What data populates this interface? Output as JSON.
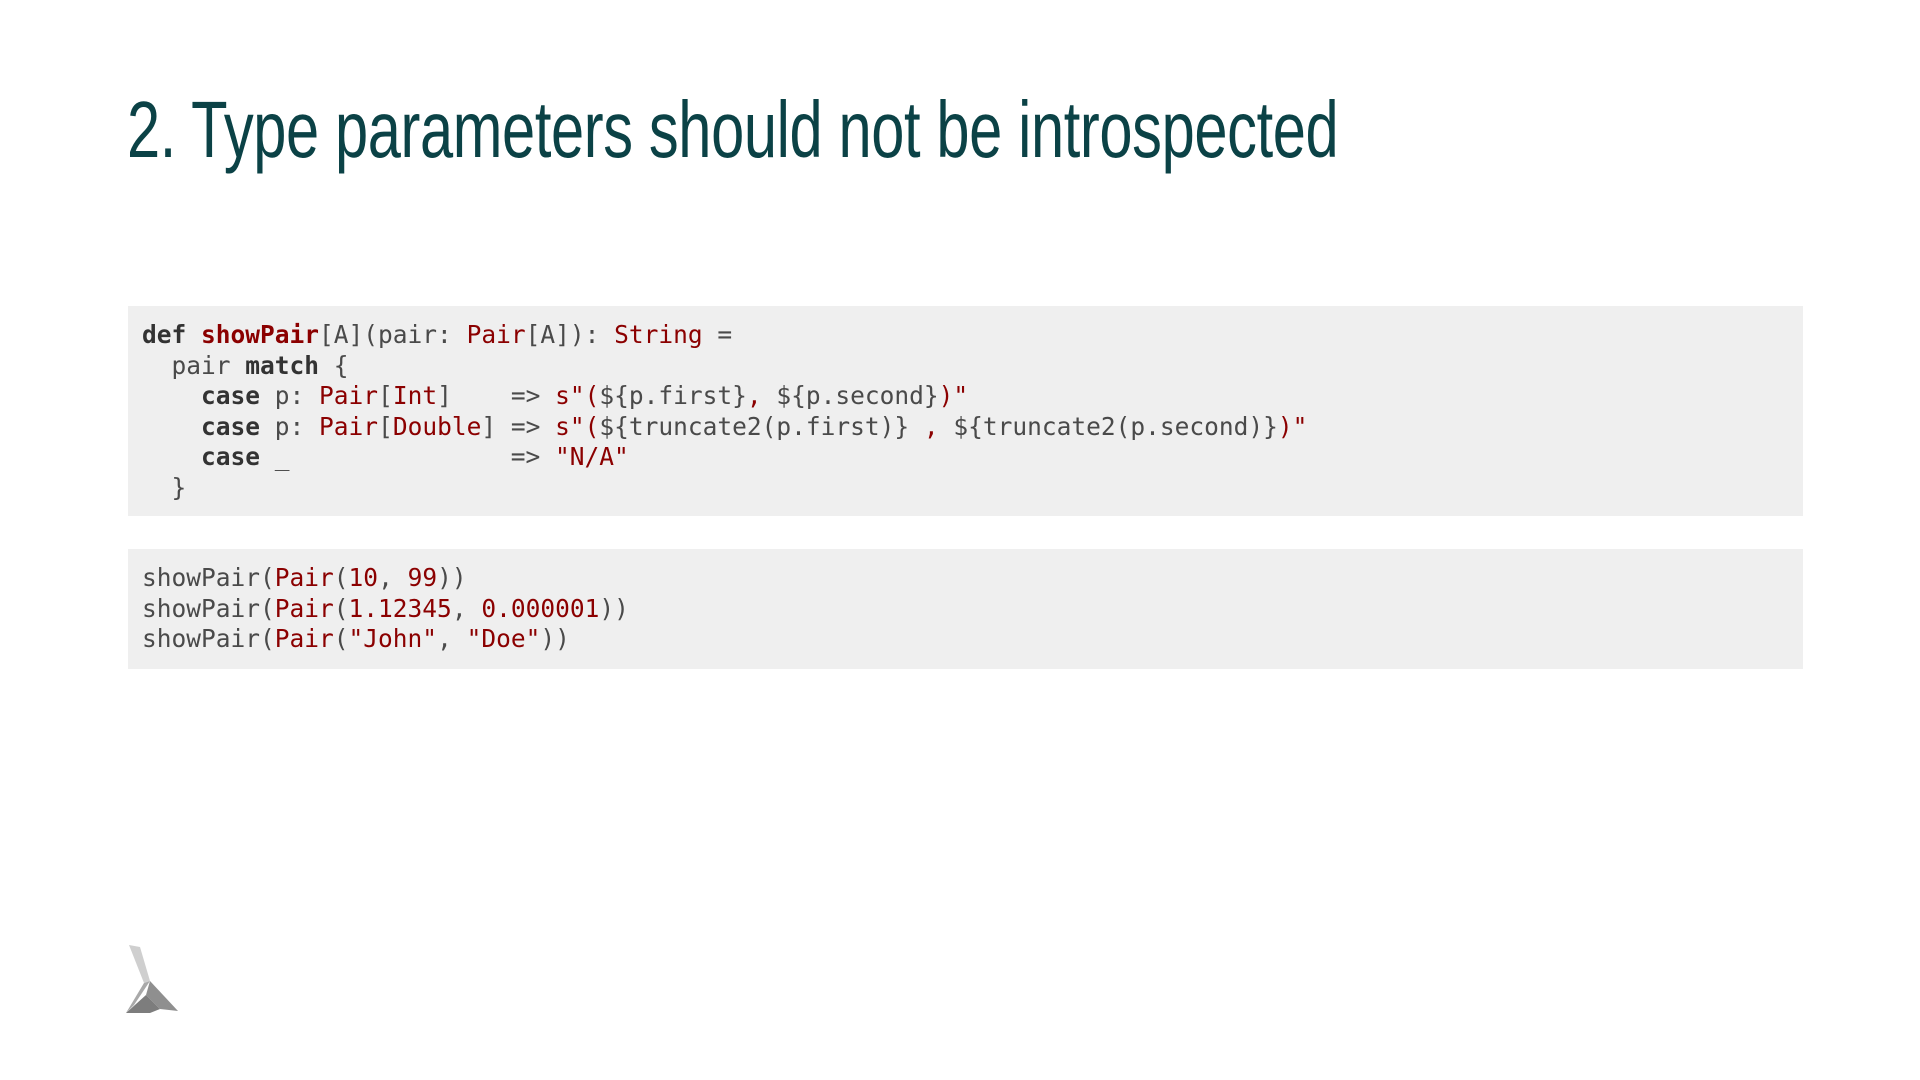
{
  "slide": {
    "title": "2. Type parameters should not be introspected"
  },
  "code_blocks": [
    {
      "lines": [
        [
          {
            "t": "def",
            "c": "kw"
          },
          {
            "t": " ",
            "c": "pl"
          },
          {
            "t": "showPair",
            "c": "fn"
          },
          {
            "t": "[A](pair: ",
            "c": "pl"
          },
          {
            "t": "Pair",
            "c": "ty"
          },
          {
            "t": "[A]): ",
            "c": "pl"
          },
          {
            "t": "String",
            "c": "ty"
          },
          {
            "t": " =",
            "c": "pl"
          }
        ],
        [
          {
            "t": "  pair ",
            "c": "pl"
          },
          {
            "t": "match",
            "c": "kw"
          },
          {
            "t": " {",
            "c": "pl"
          }
        ],
        [
          {
            "t": "    ",
            "c": "pl"
          },
          {
            "t": "case",
            "c": "kw"
          },
          {
            "t": " p: ",
            "c": "pl"
          },
          {
            "t": "Pair",
            "c": "ty"
          },
          {
            "t": "[",
            "c": "pl"
          },
          {
            "t": "Int",
            "c": "ty"
          },
          {
            "t": "]    => ",
            "c": "pl"
          },
          {
            "t": "s\"(",
            "c": "str"
          },
          {
            "t": "${p.first}",
            "c": "pl"
          },
          {
            "t": ", ",
            "c": "str"
          },
          {
            "t": "${p.second}",
            "c": "pl"
          },
          {
            "t": ")\"",
            "c": "str"
          }
        ],
        [
          {
            "t": "    ",
            "c": "pl"
          },
          {
            "t": "case",
            "c": "kw"
          },
          {
            "t": " p: ",
            "c": "pl"
          },
          {
            "t": "Pair",
            "c": "ty"
          },
          {
            "t": "[",
            "c": "pl"
          },
          {
            "t": "Double",
            "c": "ty"
          },
          {
            "t": "] => ",
            "c": "pl"
          },
          {
            "t": "s\"(",
            "c": "str"
          },
          {
            "t": "${truncate2(p.first)}",
            "c": "pl"
          },
          {
            "t": " , ",
            "c": "str"
          },
          {
            "t": "${truncate2(p.second)}",
            "c": "pl"
          },
          {
            "t": ")\"",
            "c": "str"
          }
        ],
        [
          {
            "t": "    ",
            "c": "pl"
          },
          {
            "t": "case",
            "c": "kw"
          },
          {
            "t": " _               => ",
            "c": "pl"
          },
          {
            "t": "\"N/A\"",
            "c": "str"
          }
        ],
        [
          {
            "t": "  }",
            "c": "pl"
          }
        ]
      ]
    },
    {
      "lines": [
        [
          {
            "t": "showPair(",
            "c": "pl"
          },
          {
            "t": "Pair",
            "c": "ty"
          },
          {
            "t": "(",
            "c": "pl"
          },
          {
            "t": "10",
            "c": "num"
          },
          {
            "t": ", ",
            "c": "pl"
          },
          {
            "t": "99",
            "c": "num"
          },
          {
            "t": "))",
            "c": "pl"
          }
        ],
        [
          {
            "t": "showPair(",
            "c": "pl"
          },
          {
            "t": "Pair",
            "c": "ty"
          },
          {
            "t": "(",
            "c": "pl"
          },
          {
            "t": "1.12345",
            "c": "num"
          },
          {
            "t": ", ",
            "c": "pl"
          },
          {
            "t": "0.000001",
            "c": "num"
          },
          {
            "t": "))",
            "c": "pl"
          }
        ],
        [
          {
            "t": "showPair(",
            "c": "pl"
          },
          {
            "t": "Pair",
            "c": "ty"
          },
          {
            "t": "(",
            "c": "pl"
          },
          {
            "t": "\"John\"",
            "c": "str"
          },
          {
            "t": ", ",
            "c": "pl"
          },
          {
            "t": "\"Doe\"",
            "c": "str"
          },
          {
            "t": "))",
            "c": "pl"
          }
        ]
      ]
    }
  ],
  "logo": {
    "icon": "lambda-logo-icon",
    "colors": {
      "light": "#cfcfcf",
      "mid": "#a9a9a9",
      "dark": "#7d7d7d"
    }
  }
}
